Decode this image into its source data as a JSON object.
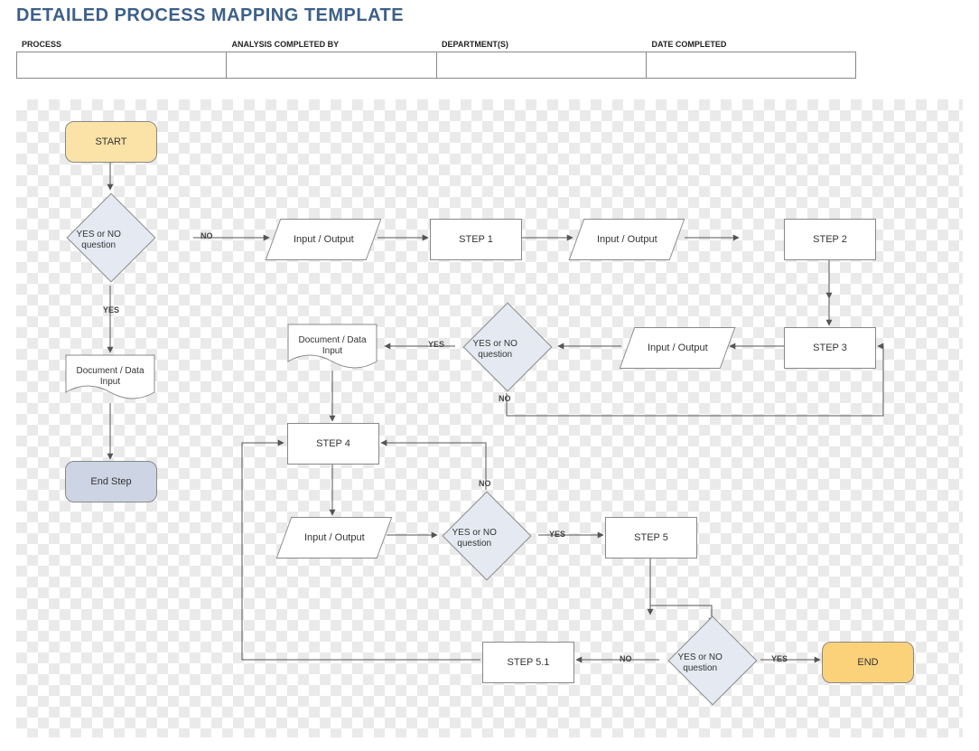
{
  "title": "DETAILED PROCESS MAPPING TEMPLATE",
  "header": {
    "process": "PROCESS",
    "analysis": "ANALYSIS COMPLETED BY",
    "department": "DEPARTMENT(S)",
    "date": "DATE COMPLETED"
  },
  "nodes": {
    "start": "START",
    "q1": "YES or NO question",
    "io1": "Input / Output",
    "step1": "STEP 1",
    "io2": "Input / Output",
    "step2": "STEP 2",
    "step3": "STEP 3",
    "io3": "Input / Output",
    "q2": "YES or NO question",
    "doc2": "Document / Data Input",
    "doc1": "Document / Data Input",
    "endstep": "End Step",
    "step4": "STEP 4",
    "io4": "Input / Output",
    "q3": "YES or NO question",
    "step5": "STEP 5",
    "step51": "STEP 5.1",
    "q4": "YES or NO question",
    "end": "END"
  },
  "labels": {
    "yes": "YES",
    "no": "NO"
  }
}
